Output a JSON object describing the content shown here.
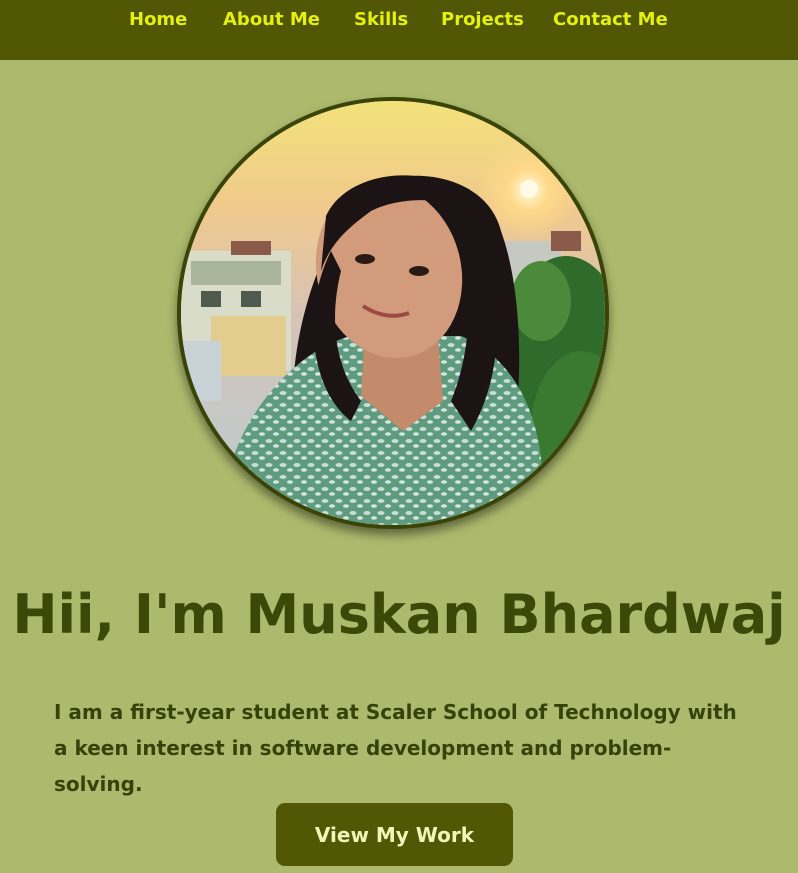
{
  "nav": {
    "items": [
      {
        "label": "Home"
      },
      {
        "label": "About Me"
      },
      {
        "label": "Skills"
      },
      {
        "label": "Projects"
      },
      {
        "label": "Contact Me"
      }
    ]
  },
  "hero": {
    "title": "Hii, I'm Muskan Bhardwaj",
    "description": "I am a first-year student at Scaler School of Technology with a keen interest in software development and problem-solving.",
    "cta_label": "View My Work"
  },
  "colors": {
    "page_background": "#adba6d",
    "navbar_background": "#515704",
    "nav_link": "#e4f00f",
    "title_text": "#3b4807",
    "button_background": "#515704",
    "button_text": "#f3f5b8"
  }
}
